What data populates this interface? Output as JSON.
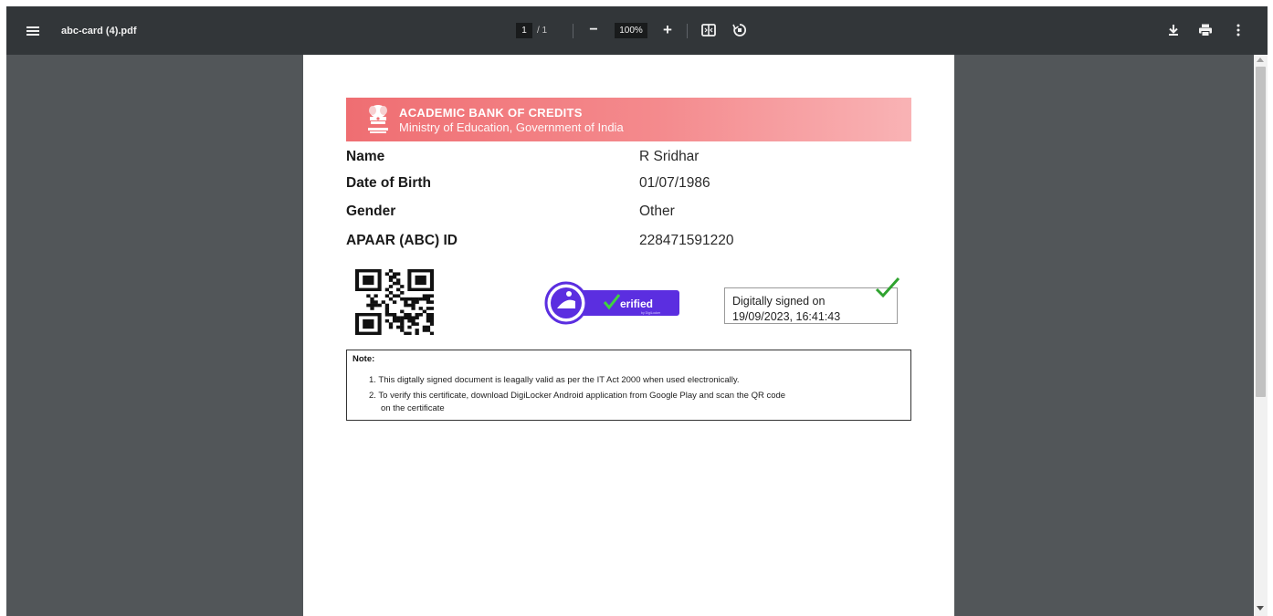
{
  "toolbar": {
    "file_name": "abc-card (4).pdf",
    "page_current": "1",
    "page_total": "/ 1",
    "zoom_out_label": "−",
    "zoom_value": "100%",
    "zoom_in_label": "+",
    "icons": [
      "menu-icon",
      "fit-page-icon",
      "rotate-icon",
      "download-icon",
      "print-icon",
      "more-vert-icon"
    ]
  },
  "card": {
    "banner": {
      "title": "ACADEMIC BANK OF CREDITS",
      "subtitle": "Ministry of Education, Government of India",
      "color": "#ef6e72"
    },
    "fields": [
      {
        "label": "Name",
        "value": "R Sridhar"
      },
      {
        "label": "Date of Birth",
        "value": "01/07/1986"
      },
      {
        "label": "Gender",
        "value": "Other"
      },
      {
        "label": "APAAR (ABC) ID",
        "value": "228471591220"
      }
    ],
    "verified_badge": {
      "text": "erified",
      "subtext": "by DigiLocker",
      "color": "#5b2ee0"
    },
    "signature": {
      "text": "Digitally signed on\n19/09/2023, 16:41:43"
    },
    "note": {
      "title": "Note:",
      "lines": [
        "1. This digtally signed document is leagally valid as per the IT Act 2000 when used electronically.",
        "2. To verify this certificate, download DigiLocker Android application from Google Play and scan the QR code",
        "on the certificate"
      ]
    }
  }
}
